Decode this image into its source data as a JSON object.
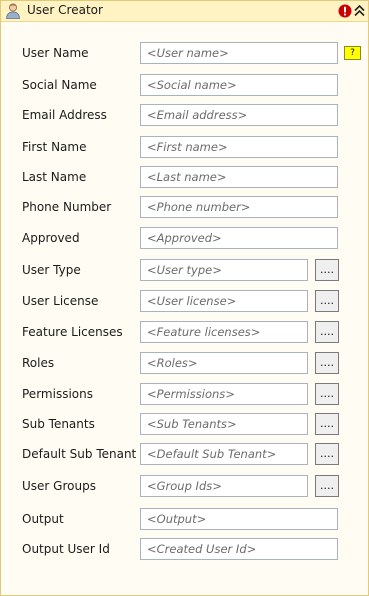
{
  "title": "User Creator",
  "icons": {
    "user": "user-icon",
    "error": "error-icon",
    "collapse": "collapse-up-icon"
  },
  "colors": {
    "title_bg": "#fff3c4",
    "panel_bg": "#fffdf3",
    "error": "#cc0000",
    "help": "#ffff00"
  },
  "help_label": "?",
  "browse_label": "....",
  "fields": [
    {
      "label": "User Name",
      "placeholder": "<User name>",
      "browse": false
    },
    {
      "label": "Social Name",
      "placeholder": "<Social name>",
      "browse": false
    },
    {
      "label": "Email Address",
      "placeholder": "<Email address>",
      "browse": false
    },
    {
      "label": "First Name",
      "placeholder": "<First name>",
      "browse": false
    },
    {
      "label": "Last Name",
      "placeholder": "<Last name>",
      "browse": false
    },
    {
      "label": "Phone Number",
      "placeholder": "<Phone number>",
      "browse": false
    },
    {
      "label": "Approved",
      "placeholder": "<Approved>",
      "browse": false
    },
    {
      "label": "User Type",
      "placeholder": "<User type>",
      "browse": true
    },
    {
      "label": "User License",
      "placeholder": "<User license>",
      "browse": true
    },
    {
      "label": "Feature Licenses",
      "placeholder": "<Feature licenses>",
      "browse": true
    },
    {
      "label": "Roles",
      "placeholder": "<Roles>",
      "browse": true
    },
    {
      "label": "Permissions",
      "placeholder": "<Permissions>",
      "browse": true
    },
    {
      "label": "Sub Tenants",
      "placeholder": "<Sub Tenants>",
      "browse": true
    },
    {
      "label": "Default Sub Tenant",
      "placeholder": "<Default Sub Tenant>",
      "browse": true
    },
    {
      "label": "User Groups",
      "placeholder": "<Group Ids>",
      "browse": true
    },
    {
      "label": "Output",
      "placeholder": "<Output>",
      "browse": false
    },
    {
      "label": "Output User Id",
      "placeholder": "<Created User Id>",
      "browse": false
    }
  ]
}
